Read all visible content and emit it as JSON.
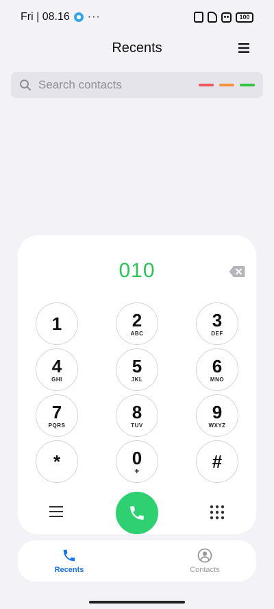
{
  "status_bar": {
    "time": "Fri | 08.16",
    "more": "···",
    "battery": "100"
  },
  "header": {
    "title": "Recents"
  },
  "search": {
    "placeholder": "Search contacts",
    "dash_colors": [
      "#f0565e",
      "#f5923a",
      "#36c23d"
    ]
  },
  "dialpad": {
    "number": "010",
    "keys": [
      {
        "digit": "1",
        "letters": ""
      },
      {
        "digit": "2",
        "letters": "ABC"
      },
      {
        "digit": "3",
        "letters": "DEF"
      },
      {
        "digit": "4",
        "letters": "GHI"
      },
      {
        "digit": "5",
        "letters": "JKL"
      },
      {
        "digit": "6",
        "letters": "MNO"
      },
      {
        "digit": "7",
        "letters": "PQRS"
      },
      {
        "digit": "8",
        "letters": "TUV"
      },
      {
        "digit": "9",
        "letters": "WXYZ"
      },
      {
        "digit": "*",
        "letters": ""
      },
      {
        "digit": "0",
        "letters": "+"
      },
      {
        "digit": "#",
        "letters": ""
      }
    ],
    "call_color": "#2fd072",
    "number_color": "#2ec25a"
  },
  "bottom_nav": {
    "recents_label": "Recents",
    "contacts_label": "Contacts",
    "active_color": "#1a73e8"
  }
}
